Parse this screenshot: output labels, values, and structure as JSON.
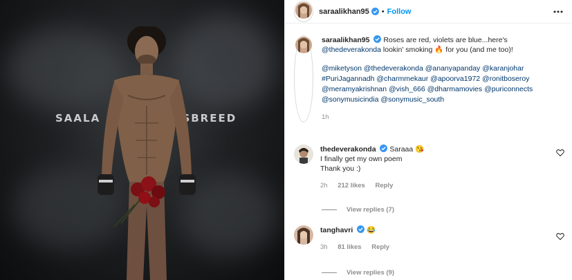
{
  "post": {
    "poster": {
      "title_left": "SAALA",
      "title_right": "CROSSBREED"
    }
  },
  "header": {
    "username": "saraalikhan95",
    "separator": "•",
    "follow_label": "Follow"
  },
  "caption": {
    "username": "saraalikhan95",
    "text_1": "Roses are red, violets are blue...here's",
    "mention": "@thedeverakonda",
    "text_2": "lookin' smoking",
    "emoji": "🔥",
    "text_3": "for you (and me too)!",
    "tags_line_1": "@miketyson @thedeverakonda @ananyapanday @karanjohar",
    "tags_line_2": "#PuriJagannadh @charmmekaur @apoorva1972 @ronitboseroy",
    "tags_line_3": "@meramyakrishnan @vish_666 @dharmamovies @puriconnects",
    "tags_line_4": "@sonymusicindia @sonymusic_south",
    "time": "1h"
  },
  "comments": [
    {
      "username": "thedeverakonda",
      "text_inline": "Saraaa",
      "emoji": "😘",
      "line_2": "I finally get my own poem",
      "line_3": "Thank you :)",
      "time": "2h",
      "likes": "212 likes",
      "reply_label": "Reply",
      "view_replies": "View replies (7)"
    },
    {
      "username": "tanghavri",
      "text_inline": "",
      "emoji": "😂",
      "time": "3h",
      "likes": "81 likes",
      "reply_label": "Reply",
      "view_replies": "View replies (9)"
    }
  ],
  "colors": {
    "link": "#00376b",
    "follow": "#0095f6",
    "verified": "#3897f0",
    "muted": "#8e8e8e"
  }
}
